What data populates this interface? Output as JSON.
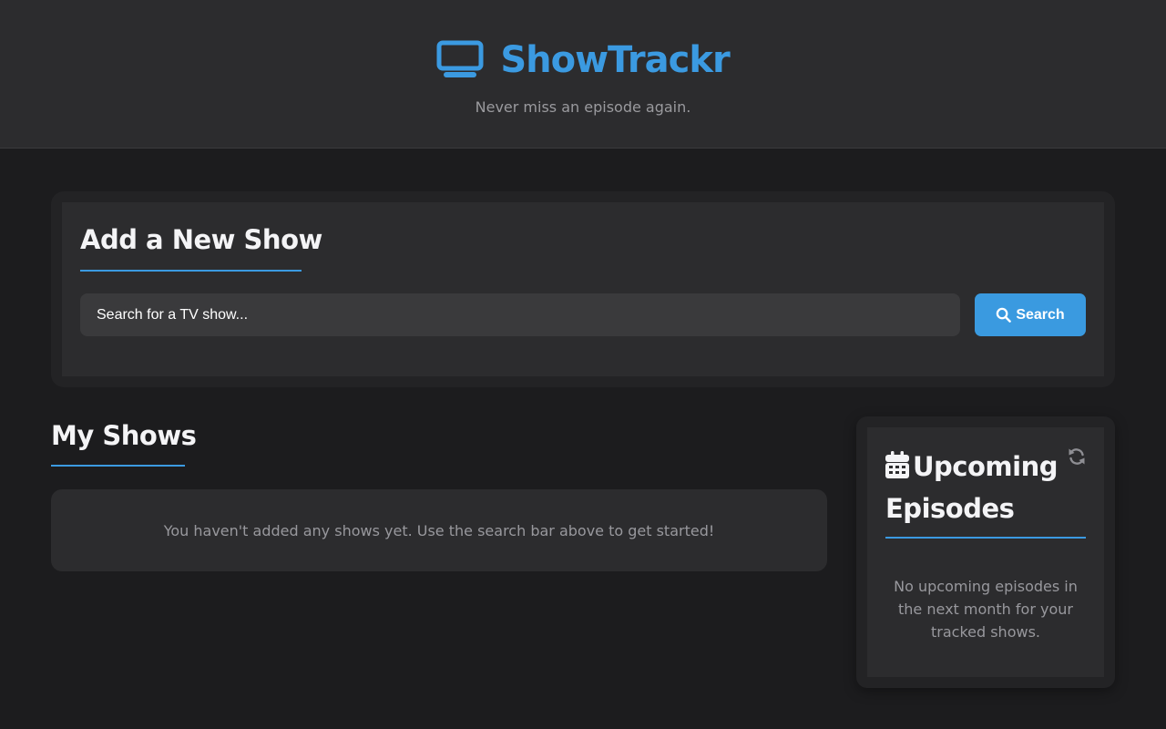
{
  "app": {
    "title": "ShowTrackr",
    "tagline": "Never miss an episode again.",
    "brand_icon": "tv-icon",
    "accent_color": "#3b9ae1"
  },
  "add_show": {
    "heading": "Add a New Show",
    "search": {
      "placeholder": "Search for a TV show...",
      "value": "",
      "button_label": "Search",
      "button_icon": "search-icon"
    }
  },
  "my_shows": {
    "heading": "My Shows",
    "empty_message": "You haven't added any shows yet. Use the search bar above to get started!"
  },
  "upcoming": {
    "heading": "Upcoming Episodes",
    "heading_icon": "calendar-icon",
    "refresh_icon": "refresh-icon",
    "empty_message": "No upcoming episodes in the next month for your tracked shows."
  }
}
